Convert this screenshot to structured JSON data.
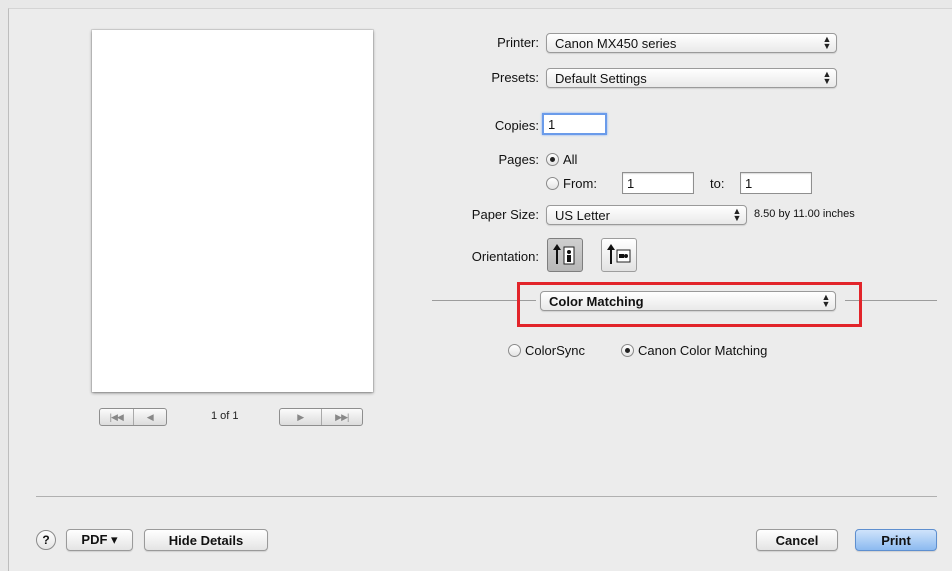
{
  "preview": {
    "page_indicator": "1 of 1",
    "nav_first": "|◀◀",
    "nav_prev": "◀",
    "nav_next": "▶",
    "nav_last": "▶▶|"
  },
  "printer": {
    "label": "Printer:",
    "value": "Canon MX450 series"
  },
  "presets": {
    "label": "Presets:",
    "value": "Default Settings"
  },
  "copies": {
    "label": "Copies:",
    "value": "1"
  },
  "pages": {
    "label": "Pages:",
    "all_label": "All",
    "from_label": "From:",
    "from_value": "1",
    "to_label": "to:",
    "to_value": "1",
    "selected": "All"
  },
  "paper_size": {
    "label": "Paper Size:",
    "value": "US Letter",
    "dimensions": "8.50 by 11.00 inches"
  },
  "orientation": {
    "label": "Orientation:",
    "selected": "portrait"
  },
  "section_popup": {
    "value": "Color Matching"
  },
  "color_matching": {
    "option_1": "ColorSync",
    "option_2": "Canon Color Matching",
    "selected": "Canon Color Matching"
  },
  "bottom_bar": {
    "help": "?",
    "pdf_label": "PDF ▾",
    "hide_details_label": "Hide Details",
    "cancel_label": "Cancel",
    "print_label": "Print"
  },
  "colors": {
    "highlight": "#e2242a",
    "default_button": "#8cbaf0"
  }
}
